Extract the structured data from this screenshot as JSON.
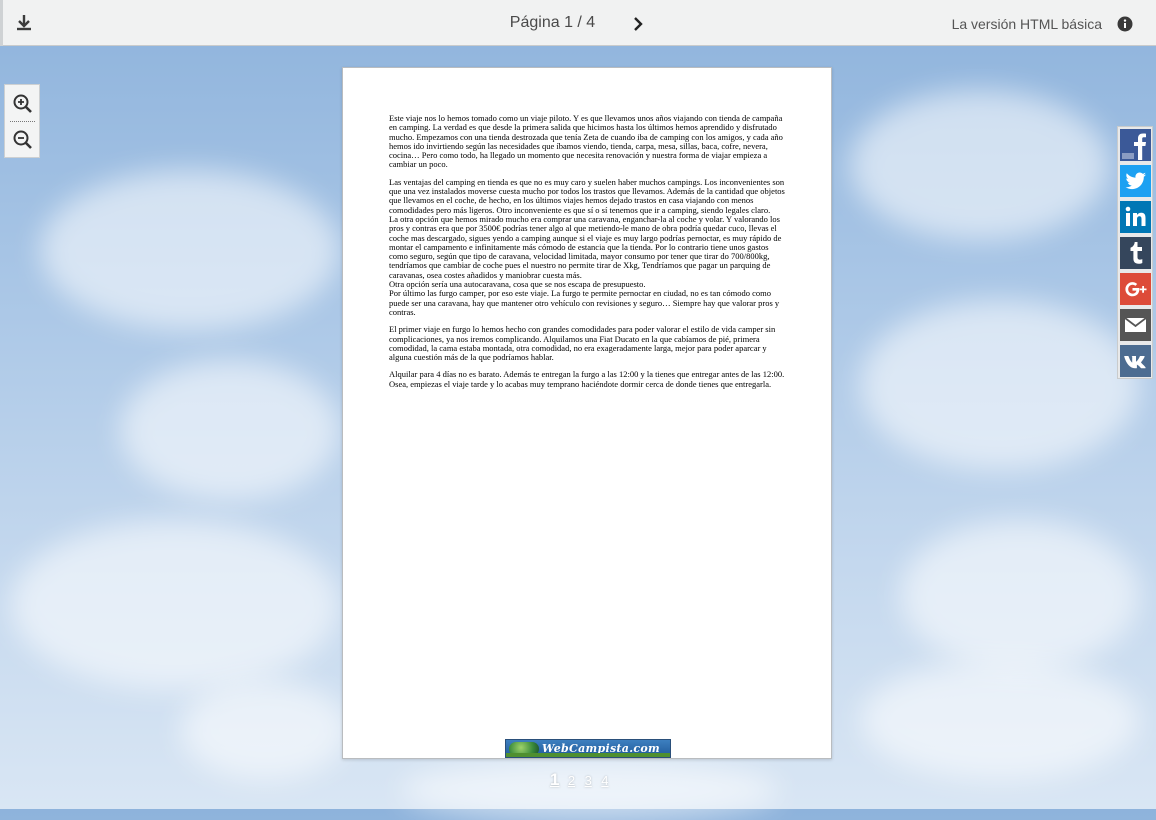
{
  "toolbar": {
    "download_icon": "download-icon",
    "page_indicator": "Página 1 / 4",
    "next_icon": "chevron-right-icon",
    "basic_version_label": "La versión HTML básica",
    "info_icon": "info-icon"
  },
  "zoom": {
    "zoom_in_icon": "zoom-in-icon",
    "zoom_out_icon": "zoom-out-icon"
  },
  "document": {
    "paragraphs": [
      "Este viaje nos lo hemos tomado como un viaje piloto. Y es que llevamos unos años viajando con tienda de campaña en camping. La verdad es que desde la primera salida que hicimos hasta los últimos hemos aprendido y disfrutado mucho. Empezamos con una tienda destrozada que tenía Zeta de cuando iba de camping con los amigos, y cada año hemos ido invirtiendo según las necesidades que íbamos viendo, tienda, carpa, mesa, sillas, baca, cofre, nevera, cocina… Pero como todo, ha llegado un momento que necesita renovación y nuestra forma de viajar empieza a cambiar un poco.",
      "Las ventajas del camping en tienda es que no es muy caro y suelen haber muchos campings. Los inconvenientes son que una vez instalados moverse cuesta mucho por todos los trastos que llevamos. Además de la cantidad que objetos que llevamos en el coche, de hecho, en los últimos viajes hemos dejado trastos en casa viajando con menos comodidades pero más ligeros. Otro inconveniente es que sí o sí tenemos que ir a camping, siendo legales claro.",
      "La otra opción que hemos mirado mucho era comprar una caravana, enganchar-la al coche y volar. Y valorando los pros y contras era que por 3500€ podrías tener algo al que metiendo-le mano de obra podría quedar cuco, llevas el coche mas descargado, sigues yendo a camping aunque si el viaje es muy largo podrías pernoctar, es muy rápido de montar el campamento e infinitamente más cómodo de estancia que la tienda. Por lo contrario tiene unos gastos como seguro, según que tipo de caravana, velocidad limitada, mayor consumo por tener que tirar do 700/800kg, tendríamos que cambiar de coche pues el nuestro no permite tirar de Xkg, Tendríamos que pagar un parquing de caravanas, osea costes añadidos y maniobrar cuesta más.",
      "Otra opción sería una autocaravana, cosa que se nos escapa de presupuesto.",
      "Por último las furgo camper, por eso este viaje. La furgo te permite pernoctar en ciudad, no es tan cómodo como puede ser una caravana, hay que mantener otro vehículo con revisiones y seguro… Siempre hay que valorar pros y contras.",
      "El primer viaje en furgo lo hemos hecho con grandes comodidades para poder valorar el estilo de vida camper sin complicaciones, ya nos iremos complicando. Alquilamos una Fiat Ducato en la que cabíamos de pié, primera comodidad, la cama estaba montada, otra comodidad, no era exageradamente larga, mejor para poder aparcar y alguna cuestión más de la que podríamos hablar.",
      "Alquilar para 4 días no es barato. Además te entregan la furgo a las 12:00 y la tienes que entregar antes de las 12:00. Osea, empiezas el viaje tarde y lo acabas muy temprano haciéndote dormir cerca de donde tienes que entregarla."
    ],
    "logo_text": "WebCampista.com"
  },
  "pagination": {
    "pages": [
      "1",
      "2",
      "3",
      "4"
    ],
    "current": "1"
  },
  "social": {
    "buttons": [
      {
        "name": "facebook",
        "icon": "facebook-icon",
        "color": "#3b5998"
      },
      {
        "name": "twitter",
        "icon": "twitter-icon",
        "color": "#1da1f2"
      },
      {
        "name": "linkedin",
        "icon": "linkedin-icon",
        "color": "#0077b5"
      },
      {
        "name": "tumblr",
        "icon": "tumblr-icon",
        "color": "#35465c"
      },
      {
        "name": "google-plus",
        "icon": "google-plus-icon",
        "color": "#dd4b39"
      },
      {
        "name": "email",
        "icon": "mail-icon",
        "color": "#555555"
      },
      {
        "name": "vk",
        "icon": "vk-icon",
        "color": "#4c6c91"
      }
    ]
  }
}
